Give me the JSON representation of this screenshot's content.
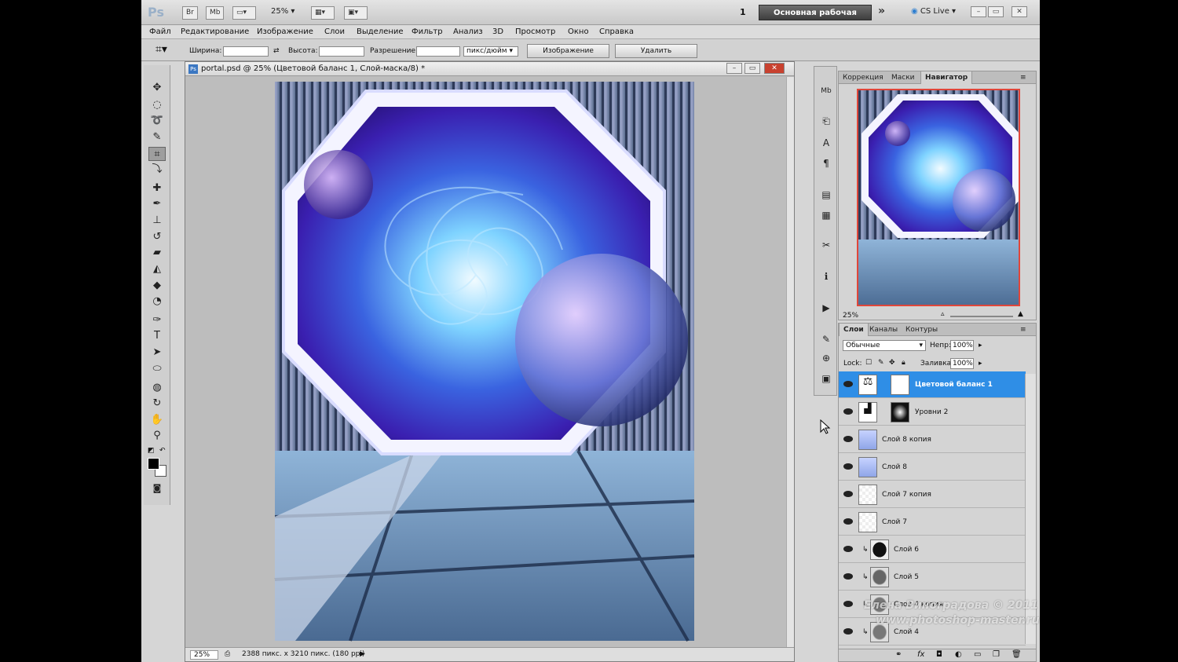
{
  "app": {
    "logo": "Ps",
    "launch": [
      "Br",
      "Mb"
    ],
    "zoom": "25%",
    "workspace_number": "1",
    "workspace": "Основная рабочая среда",
    "more": "»",
    "cslive": "CS Live ▾"
  },
  "menu": [
    "Файл",
    "Редактирование",
    "Изображение",
    "Слои",
    "Выделение",
    "Фильтр",
    "Анализ",
    "3D",
    "Просмотр",
    "Окно",
    "Справка"
  ],
  "options": {
    "width_label": "Ширина:",
    "height_label": "Высота:",
    "resolution_label": "Разрешение:",
    "units": "пикс/дюйм",
    "image_button": "Изображение",
    "delete_button": "Удалить"
  },
  "document": {
    "title": "portal.psd @ 25% (Цветовой баланс 1, Слой-маска/8) *",
    "zoom": "25%",
    "info": "2388 пикс. x 3210 пикс. (180 ppi)"
  },
  "navigator": {
    "tabs": [
      "Коррекция",
      "Маски",
      "Навигатор"
    ],
    "active_tab": "Навигатор",
    "zoom": "25%"
  },
  "layers": {
    "tabs": [
      "Слои",
      "Каналы",
      "Контуры"
    ],
    "blend_mode": "Обычные",
    "opacity_label": "Непр:",
    "opacity": "100%",
    "lock_label": "Lock:",
    "fill_label": "Заливка:",
    "fill": "100%",
    "items": [
      {
        "name": "Цветовой баланс 1",
        "selected": true
      },
      {
        "name": "Уровни 2",
        "selected": false
      },
      {
        "name": "Слой 8 копия",
        "selected": false
      },
      {
        "name": "Слой 8",
        "selected": false
      },
      {
        "name": "Слой 7 копия",
        "selected": false
      },
      {
        "name": "Слой 7",
        "selected": false
      },
      {
        "name": "Слой 6",
        "selected": false
      },
      {
        "name": "Слой 5",
        "selected": false
      },
      {
        "name": "Слой 4 копия",
        "selected": false
      },
      {
        "name": "Слой 4",
        "selected": false
      }
    ]
  },
  "watermark": {
    "author": "Елена Виноградова © 2011",
    "site": "www.photoshop-master.ru"
  },
  "colors": {
    "accent_selection": "#2f8ee6",
    "close_button": "#c8412f",
    "navigator_frame": "#e0463a"
  }
}
